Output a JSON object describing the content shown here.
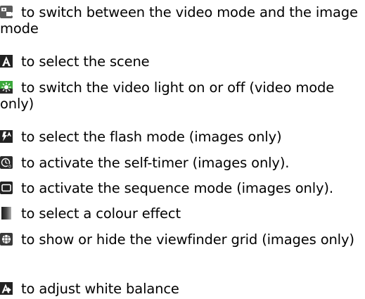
{
  "items": [
    {
      "icon": "camera-mode-icon",
      "text": "to switch between the video mode and the image mode"
    },
    {
      "icon": "scene-icon",
      "text": "to select the scene"
    },
    {
      "icon": "video-light-icon",
      "text": "to switch the video light on or off (video mode only)"
    },
    {
      "icon": "flash-icon",
      "text": "to select the flash mode (images only)"
    },
    {
      "icon": "self-timer-icon",
      "text": "to activate the self-timer (images only)."
    },
    {
      "icon": "sequence-mode-icon",
      "text": "to activate the sequence mode (images only)."
    },
    {
      "icon": "colour-effect-icon",
      "text": "to select a colour effect"
    },
    {
      "icon": "viewfinder-grid-icon",
      "text": "to show or hide the viewfinder grid (images only)"
    },
    {
      "icon": "white-balance-icon",
      "text": "to adjust white balance"
    }
  ],
  "colors": {
    "text": "#000000",
    "icon_dark": "#222222",
    "icon_accent": "#3aa83a"
  }
}
